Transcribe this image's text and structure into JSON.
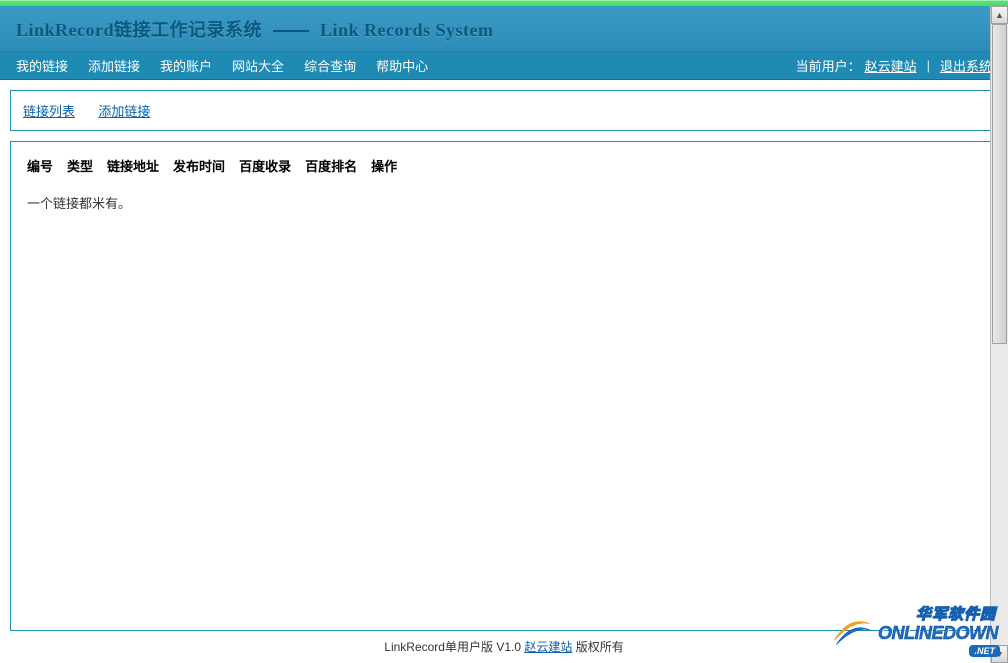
{
  "header": {
    "title_cn": "LinkRecord链接工作记录系统",
    "title_en": "Link Records System"
  },
  "nav": {
    "items": [
      {
        "label": "我的链接"
      },
      {
        "label": "添加链接"
      },
      {
        "label": "我的账户"
      },
      {
        "label": "网站大全"
      },
      {
        "label": "综合查询"
      },
      {
        "label": "帮助中心"
      }
    ],
    "user_prefix": "当前用户：",
    "user_name": "赵云建站",
    "logout": "退出系统"
  },
  "tabs": {
    "link_list": "链接列表",
    "add_link": "添加链接"
  },
  "table": {
    "columns": [
      {
        "label": "编号"
      },
      {
        "label": "类型"
      },
      {
        "label": "链接地址"
      },
      {
        "label": "发布时间"
      },
      {
        "label": "百度收录"
      },
      {
        "label": "百度排名"
      },
      {
        "label": "操作"
      }
    ],
    "empty_message": "一个链接都米有。"
  },
  "footer": {
    "prefix": "LinkRecord单用户版 V1.0 ",
    "link": "赵云建站",
    "suffix": " 版权所有"
  },
  "watermark": {
    "cn": "华军软件园",
    "en": "ONLINEDOWN",
    "net": ".NET"
  }
}
